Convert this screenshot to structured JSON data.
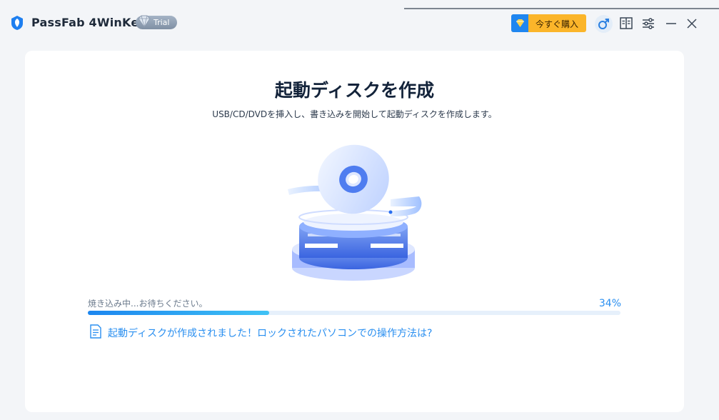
{
  "app": {
    "title": "PassFab 4WinKey",
    "badge": "Trial"
  },
  "toolbar": {
    "buy_label": "今すぐ購入",
    "icons": [
      "user-icon",
      "book-icon",
      "settings-sliders-icon",
      "minimize-icon",
      "close-icon"
    ]
  },
  "main": {
    "title": "起動ディスクを作成",
    "subtitle": "USB/CD/DVDを挿入し、書き込みを開始して起動ディスクを作成します。",
    "progress": {
      "label": "焼き込み中...お待ちください。",
      "percent_text": "34%",
      "value": 0.34
    },
    "help_link": "起動ディスクが作成されました！ロックされたパソコンでの操作方法は?"
  },
  "colors": {
    "accent": "#2a8ff0",
    "buy": "#fbb52a",
    "title": "#13233a"
  }
}
